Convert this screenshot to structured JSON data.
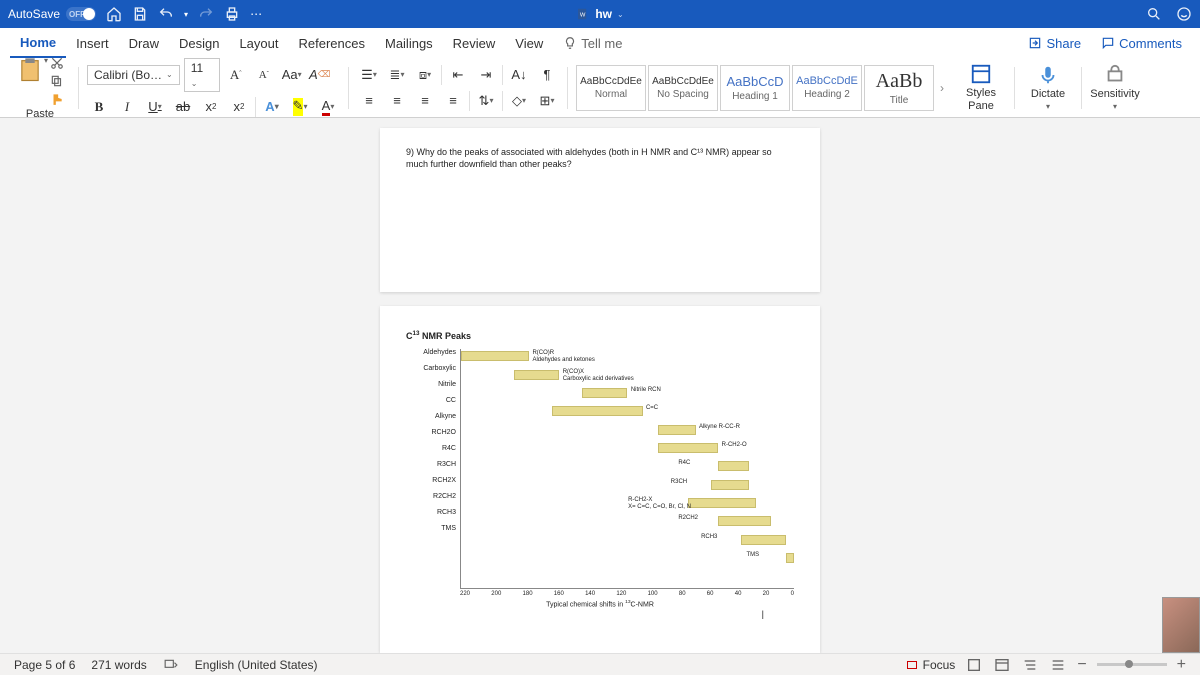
{
  "titlebar": {
    "autosave": "AutoSave",
    "autosave_state": "OFF",
    "doc_name": "hw"
  },
  "tabs": [
    "Home",
    "Insert",
    "Draw",
    "Design",
    "Layout",
    "References",
    "Mailings",
    "Review",
    "View"
  ],
  "tellme": "Tell me",
  "share": "Share",
  "comments": "Comments",
  "ribbon": {
    "paste": "Paste",
    "font_name": "Calibri (Bo…",
    "font_size": "11",
    "styles": [
      {
        "preview": "AaBbCcDdEe",
        "label": "Normal",
        "cls": ""
      },
      {
        "preview": "AaBbCcDdEe",
        "label": "No Spacing",
        "cls": ""
      },
      {
        "preview": "AaBbCcD",
        "label": "Heading 1",
        "cls": "h1"
      },
      {
        "preview": "AaBbCcDdE",
        "label": "Heading 2",
        "cls": "h2"
      },
      {
        "preview": "AaBb",
        "label": "Title",
        "cls": "ti"
      }
    ],
    "styles_pane": "Styles Pane",
    "dictate": "Dictate",
    "sensitivity": "Sensitivity"
  },
  "document": {
    "question": "9) Why do the peaks of associated with aldehydes (both in H NMR and C¹³ NMR) appear so much further downfield than other peaks?",
    "cursor": "|"
  },
  "chart_data": {
    "type": "bar",
    "title": "C¹³ NMR Peaks",
    "xlabel": "Typical chemical shifts in ¹³C-NMR",
    "ylabel": "",
    "xlim": [
      0,
      220
    ],
    "x_ticks": [
      220,
      200,
      180,
      160,
      140,
      120,
      100,
      80,
      60,
      40,
      20,
      0
    ],
    "categories": [
      "Aldehydes",
      "Carboxylic",
      "Nitrile",
      "CC",
      "Alkyne",
      "RCH2O",
      "R4C",
      "R3CH",
      "RCH2X",
      "R2CH2",
      "RCH3",
      "TMS"
    ],
    "series": [
      {
        "name": "range",
        "values": [
          [
            175,
            220
          ],
          [
            155,
            185
          ],
          [
            110,
            140
          ],
          [
            100,
            160
          ],
          [
            65,
            90
          ],
          [
            50,
            90
          ],
          [
            30,
            50
          ],
          [
            30,
            55
          ],
          [
            25,
            70
          ],
          [
            15,
            50
          ],
          [
            5,
            35
          ],
          [
            0,
            5
          ]
        ]
      }
    ],
    "annotations": [
      "R(CO)R",
      "Aldehydes and ketones",
      "R(CO)X",
      "Carboxylic acid derivatives",
      "Nitrile RCN",
      "C=C",
      "Alkyne R-CC-R",
      "R-CH2-O",
      "R4C",
      "R3CH",
      "R-CH2-X",
      "X= C=C, C=O, Br, Cl, N",
      "R2CH2",
      "RCH3",
      "TMS"
    ]
  },
  "statusbar": {
    "page": "Page 5 of 6",
    "words": "271 words",
    "lang": "English (United States)",
    "focus": "Focus"
  }
}
